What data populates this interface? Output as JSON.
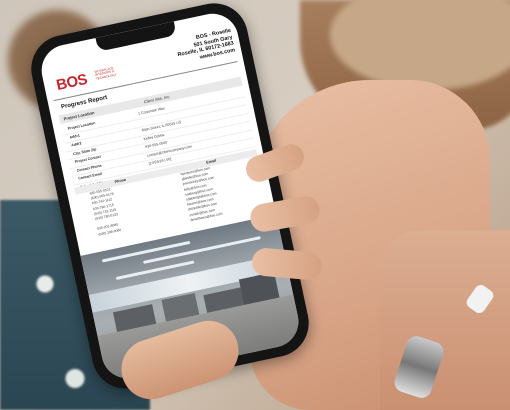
{
  "document": {
    "logo_text": "BOS",
    "logo_tagline": "WORKPLACE INTERIORS & TECHNOLOGY",
    "company_name": "BOS - Roselle",
    "address_line": "501 South Gary",
    "city_line": "Roselle, IL 60172-1683",
    "website": "www.bos.com",
    "report_title": "Progress Report",
    "header_row": {
      "label": "Project Location",
      "value": "Client Site, Inc."
    },
    "info_rows": [
      {
        "label": "Project Location",
        "value": "1 Corporate Way"
      },
      {
        "label": "Addr1",
        "value": ""
      },
      {
        "label": "Addr2",
        "value": "Main Street, IL 60015 US"
      },
      {
        "label": "City, State Zip",
        "value": "Kelley Dobbs"
      },
      {
        "label": "Project Contact",
        "value": "630-555-0000"
      },
      {
        "label": "Contact Phone",
        "value": "contact@clientcompany.com"
      },
      {
        "label": "Contact Email",
        "value": "[10/24/19 | 00]"
      },
      {
        "label": "Scheduled Dt",
        "value": ""
      }
    ],
    "contacts_header": {
      "phone": "Phone",
      "email": "Email"
    },
    "contacts": [
      {
        "phone": "630-555-0101",
        "email": "bprojects@bos.com"
      },
      {
        "phone": "(630) 555-0178",
        "email": "gbasile@bos.com"
      },
      {
        "phone": "630-742-1112",
        "email": "jrwinrickey@bos.com"
      },
      {
        "phone": "630-780-1715",
        "email": "kelly@bos.com"
      },
      {
        "phone": "(630) 742-1115",
        "email": "ssaberg@bos.com"
      },
      {
        "phone": "(630) 780-0133",
        "email": "sdebbrigh@bos.com"
      },
      {
        "phone": "",
        "email": "kwatos@bos.com"
      },
      {
        "phone": "630-202-8080",
        "email": "dstricklin@bos.com"
      },
      {
        "phone": "(630) 208-0000",
        "email": "ssmith@bos.com"
      },
      {
        "phone": "",
        "email": "dmatthews@bos.com"
      }
    ]
  },
  "colors": {
    "brand_red": "#c8262d",
    "phone_frame": "#141414"
  }
}
